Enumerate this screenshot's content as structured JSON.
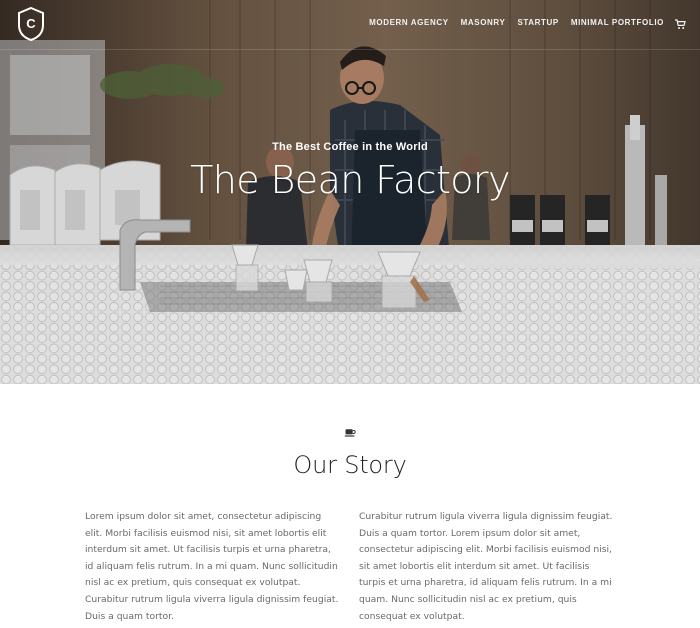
{
  "nav": {
    "links": [
      "MODERN AGENCY",
      "MASONRY",
      "STARTUP",
      "MINIMAL PORTFOLIO"
    ],
    "logo_letter": "C",
    "cart_icon": "cart-icon"
  },
  "hero": {
    "subtitle": "The Best Coffee in the World",
    "title": "The Bean Factory"
  },
  "story": {
    "icon": "coffee-cup-icon",
    "title": "Our Story",
    "col_left": "Lorem ipsum dolor sit amet, consectetur adipiscing elit. Morbi facilisis euismod nisi, sit amet lobortis elit interdum sit amet. Ut facilisis turpis et urna pharetra, id aliquam felis rutrum. In a mi quam. Nunc sollicitudin nisl ac ex pretium, quis consequat ex volutpat. Curabitur rutrum ligula viverra ligula dignissim feugiat. Duis a quam tortor.",
    "col_right": "Curabitur rutrum ligula viverra ligula dignissim feugiat. Duis a quam tortor. Lorem ipsum dolor sit amet, consectetur adipiscing elit. Morbi facilisis euismod nisi, sit amet lobortis elit interdum sit amet. Ut facilisis turpis et urna pharetra, id aliquam felis rutrum. In a mi quam. Nunc sollicitudin nisl ac ex pretium, quis consequat ex volutpat."
  },
  "colors": {
    "nav_text": "#f2f2f2",
    "hero_text": "#ffffff",
    "body_text": "#6a6a6a",
    "heading_text": "#222222"
  }
}
